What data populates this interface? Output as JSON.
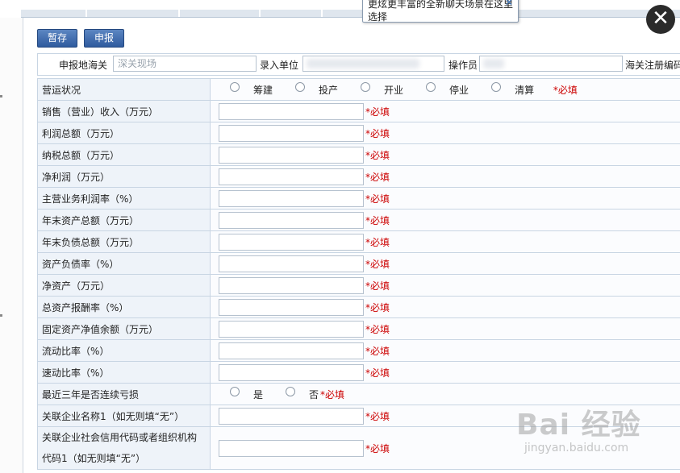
{
  "tooltip": {
    "text": "更炫更丰富的全新聊天场景在这里选择",
    "close": "✕"
  },
  "close_button": "✕",
  "toolbar": {
    "save_draft": "暂存",
    "submit": "申报"
  },
  "header": {
    "customs_label": "申报地海关",
    "customs_value": "深关现场",
    "entry_unit_label": "录入单位",
    "operator_label": "操作员",
    "customs_reg_label": "海关注册编码"
  },
  "required_mark": "*必填",
  "status_row": {
    "label": "营运状况",
    "options": [
      "筹建",
      "投产",
      "开业",
      "停业",
      "清算"
    ]
  },
  "rows": [
    "销售（营业）收入（万元）",
    "利润总额（万元）",
    "纳税总额（万元）",
    "净利润（万元）",
    "主营业务利润率（%）",
    "年末资产总额（万元）",
    "年末负债总额（万元）",
    "资产负债率（%）",
    "净资产（万元）",
    "总资产报酬率（%）",
    "固定资产净值余额（万元）",
    "流动比率（%）",
    "速动比率（%）"
  ],
  "loss_row": {
    "label": "最近三年是否连续亏损",
    "options": [
      "是",
      "否"
    ]
  },
  "related_name_row": {
    "label": "关联企业名称1（如无则填“无”）"
  },
  "related_code_row": {
    "label_line1": "关联企业社会信用代码或者组织机构",
    "label_line2": "代码1（如无则填“无”）"
  },
  "watermark": {
    "brand": "Bai  经验",
    "url": "jingyan.baidu.com"
  }
}
